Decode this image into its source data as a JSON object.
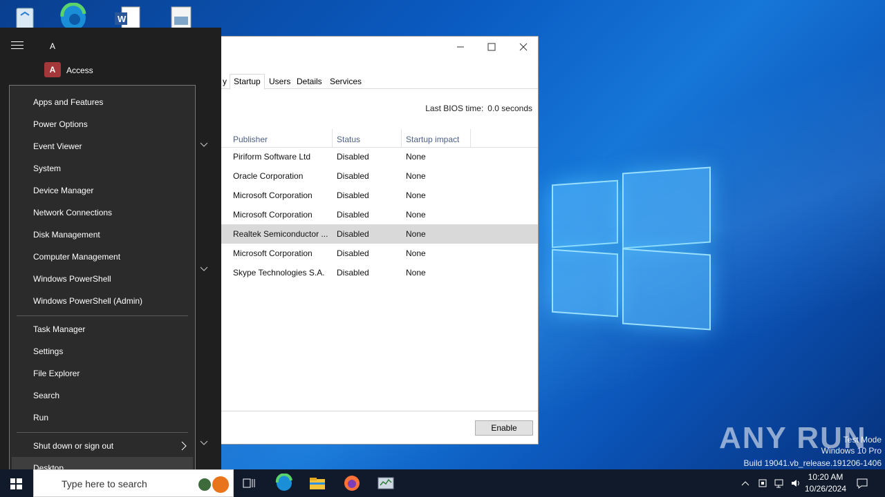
{
  "task_manager": {
    "tabs": [
      "y",
      "Startup",
      "Users",
      "Details",
      "Services"
    ],
    "active_tab": "Startup",
    "bios_label": "Last BIOS time:",
    "bios_value": "0.0 seconds",
    "columns": [
      "Publisher",
      "Status",
      "Startup impact"
    ],
    "rows": [
      {
        "publisher": "Piriform Software Ltd",
        "status": "Disabled",
        "impact": "None"
      },
      {
        "publisher": "Oracle Corporation",
        "status": "Disabled",
        "impact": "None"
      },
      {
        "publisher": "Microsoft Corporation",
        "status": "Disabled",
        "impact": "None"
      },
      {
        "publisher": "Microsoft Corporation",
        "status": "Disabled",
        "impact": "None"
      },
      {
        "publisher": "Realtek Semiconductor ...",
        "status": "Disabled",
        "impact": "None"
      },
      {
        "publisher": "Microsoft Corporation",
        "status": "Disabled",
        "impact": "None"
      },
      {
        "publisher": "Skype Technologies S.A.",
        "status": "Disabled",
        "impact": "None"
      }
    ],
    "selected_row": 4,
    "enable_button": "Enable"
  },
  "start_menu": {
    "letter": "A",
    "app": "Access"
  },
  "winx_menu": {
    "group1": [
      "Apps and Features",
      "Power Options",
      "Event Viewer",
      "System",
      "Device Manager",
      "Network Connections",
      "Disk Management",
      "Computer Management",
      "Windows PowerShell",
      "Windows PowerShell (Admin)"
    ],
    "group2": [
      "Task Manager",
      "Settings",
      "File Explorer",
      "Search",
      "Run"
    ],
    "shutdown": "Shut down or sign out",
    "desktop": "Desktop"
  },
  "taskbar": {
    "search_placeholder": "Type here to search",
    "time": "10:20 AM",
    "date": "10/26/2024"
  },
  "watermark": {
    "logo": "ANY RUN",
    "line1": "Test Mode",
    "line2": "Windows 10 Pro",
    "line3": "Build 19041.vb_release.191206-1406"
  }
}
